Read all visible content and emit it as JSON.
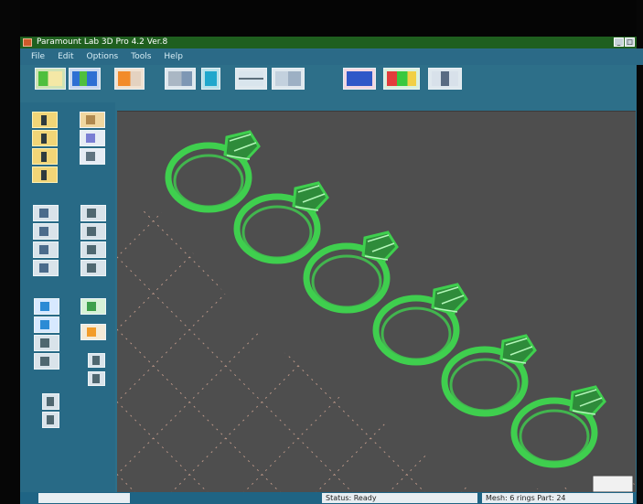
{
  "window": {
    "title": "Paramount Lab 3D Pro 4.2 Ver.8"
  },
  "menubar": {
    "items": [
      "File",
      "Edit",
      "Options",
      "Tools",
      "Help"
    ]
  },
  "toolbar": {
    "groups": [
      "tools-1",
      "tools-2",
      "tools-3",
      "tools-4",
      "tools-5",
      "tools-6",
      "tools-7",
      "tools-8",
      "tools-9",
      "tools-10"
    ]
  },
  "status": {
    "left": "",
    "middle": "Status: Ready",
    "right": "Mesh: 6 rings  Part: 24"
  },
  "viewport": {
    "grid_on": true,
    "object_count": 6,
    "object_type": "ring"
  },
  "colors": {
    "window_bg": "#2d6f89",
    "viewport_bg": "#4e4e4e",
    "model_green": "#3fd64f"
  }
}
